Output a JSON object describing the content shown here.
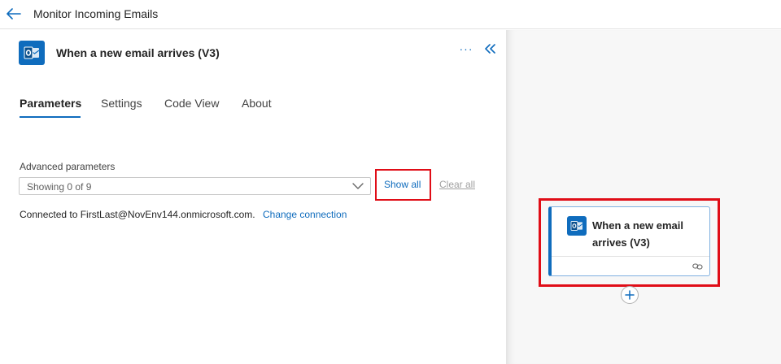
{
  "header": {
    "title": "Monitor Incoming Emails",
    "back_icon": "arrow-left-icon"
  },
  "panel": {
    "title": "When a new email arrives (V3)",
    "more_label": "···",
    "tabs": [
      {
        "label": "Parameters",
        "active": true
      },
      {
        "label": "Settings",
        "active": false
      },
      {
        "label": "Code View",
        "active": false
      },
      {
        "label": "About",
        "active": false
      }
    ],
    "advanced": {
      "label": "Advanced parameters",
      "value": "Showing 0 of 9",
      "show_all": "Show all",
      "clear_all": "Clear all"
    },
    "connection": {
      "text": "Connected to FirstLast@NovEnv144.onmicrosoft.com.",
      "change_label": "Change connection"
    }
  },
  "canvas": {
    "card": {
      "title": "When a new email arrives (V3)"
    }
  },
  "colors": {
    "accent": "#0f6cbd",
    "highlight": "#e00d17"
  }
}
